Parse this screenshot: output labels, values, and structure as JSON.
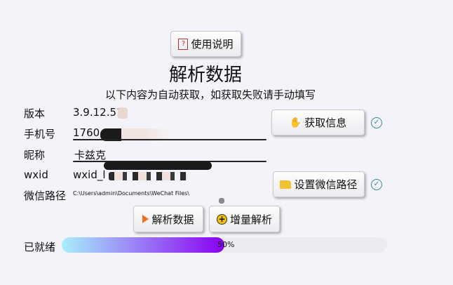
{
  "help_button": {
    "label": "使用说明",
    "icon": "question-icon"
  },
  "title": "解析数据",
  "subtitle": "以下内容为自动获取，如获取失败请手动填写",
  "fields": {
    "version": {
      "label": "版本",
      "value": "3.9.12.51"
    },
    "phone": {
      "label": "手机号",
      "value": "1760"
    },
    "nickname": {
      "label": "昵称",
      "value": "卡兹克"
    },
    "wxid": {
      "label": "wxid",
      "value": "wxid_l"
    },
    "wechat_path": {
      "label": "微信路径",
      "value": "C:\\Users\\admin\\Documents\\WeChat Files\\"
    }
  },
  "buttons": {
    "get_info": {
      "label": "获取信息",
      "icon": "hand-icon"
    },
    "set_path": {
      "label": "设置微信路径",
      "icon": "folder-icon"
    },
    "parse": {
      "label": "解析数据",
      "icon": "play-icon"
    },
    "incremental": {
      "label": "增量解析",
      "icon": "plus-circle-icon"
    }
  },
  "status": {
    "label": "已就绪",
    "progress_text": "50%",
    "progress": 0.5
  },
  "colors": {
    "progress_start": "#a8eefc",
    "progress_end": "#8a00f0",
    "check": "#3a8a9a",
    "play": "#f07020",
    "plus": "#f2c200"
  }
}
